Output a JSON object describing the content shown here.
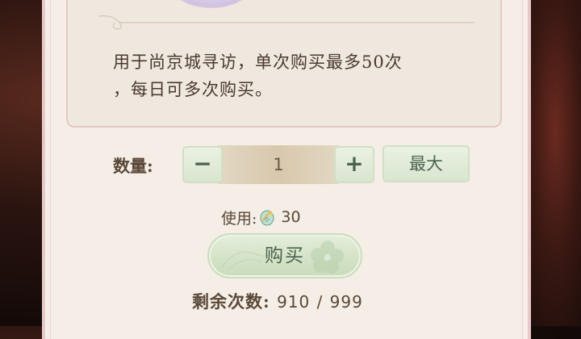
{
  "item": {
    "description_line1": "用于尚京城寻访，单次购买最多50次",
    "description_line2": "，每日可多次购买。"
  },
  "quantity": {
    "label": "数量:",
    "value": "1",
    "decrease_symbol": "−",
    "increase_symbol": "+",
    "max_label": "最大"
  },
  "cost": {
    "label": "使用:",
    "amount": "30",
    "currency_icon": "feather-coin-icon"
  },
  "buy_label": "购买",
  "remaining": {
    "label": "剩余次数:",
    "current": "910",
    "separator": "/",
    "max": "999"
  },
  "colors": {
    "panel_bg": "#f4eee6",
    "border_pink": "#e4c8c4",
    "button_green": "#d9e6cf",
    "button_text": "#4b6350",
    "text_brown": "#5a4838"
  }
}
